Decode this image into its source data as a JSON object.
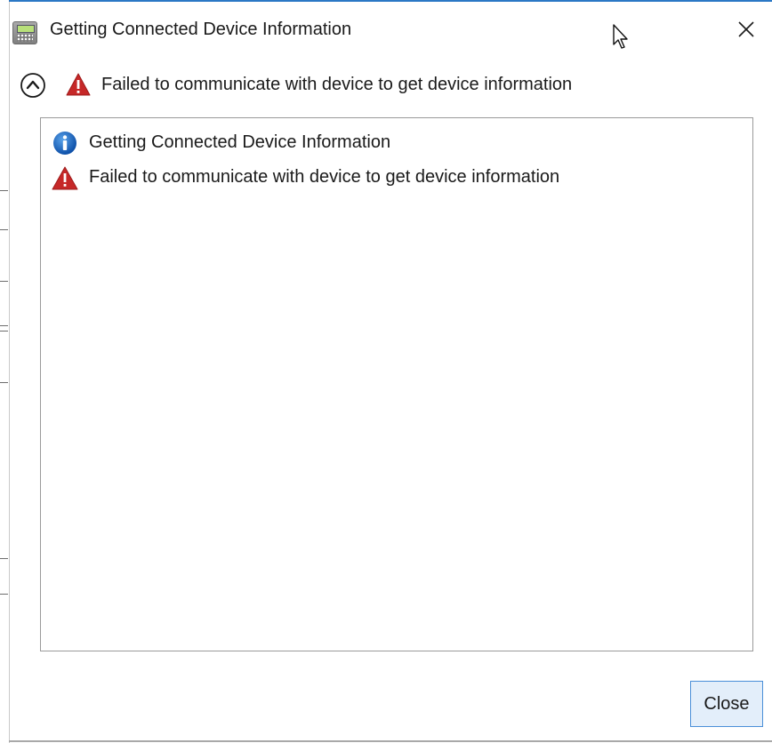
{
  "dialog": {
    "title": "Getting Connected Device Information",
    "app_icon": "device-keypad-icon",
    "close_icon": "close-icon"
  },
  "summary": {
    "collapse_icon": "chevron-up-icon",
    "status_icon": "warning-icon",
    "text": "Failed to communicate with device to get device information"
  },
  "log": {
    "entries": [
      {
        "icon": "info-icon",
        "text": "Getting Connected Device Information"
      },
      {
        "icon": "warning-icon",
        "text": "Failed to communicate with device to get device information"
      }
    ]
  },
  "footer": {
    "close_label": "Close"
  },
  "colors": {
    "warning": "#c62828",
    "info": "#1565c0",
    "button_border": "#4a8fd8",
    "button_bg": "#e3eefa"
  }
}
